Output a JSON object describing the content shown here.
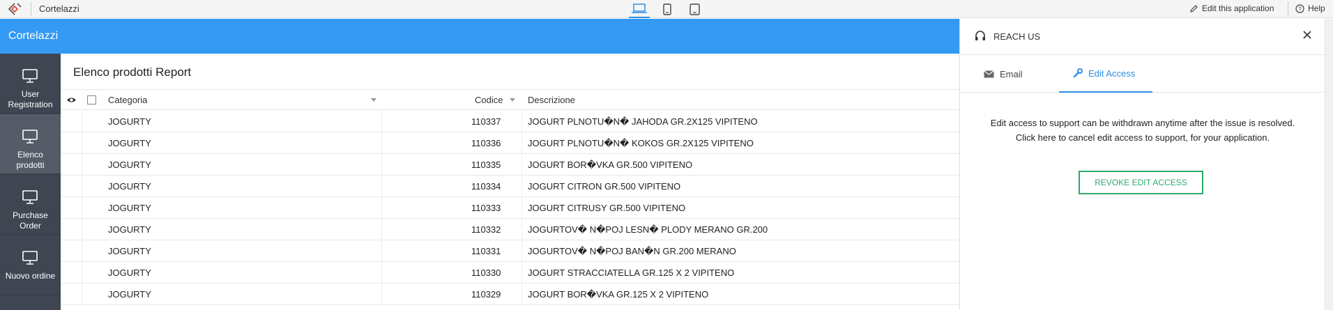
{
  "topbar": {
    "app_name": "Cortelazzi",
    "edit_app_label": "Edit this application",
    "help_label": "Help"
  },
  "header": {
    "title": "Cortelazzi"
  },
  "sidebar": {
    "items": [
      {
        "label_line1": "User",
        "label_line2": "Registration"
      },
      {
        "label_line1": "Elenco",
        "label_line2": "prodotti"
      },
      {
        "label_line1": "Purchase",
        "label_line2": "Order"
      },
      {
        "label_line1": "Nuovo ordine",
        "label_line2": ""
      }
    ]
  },
  "report": {
    "title": "Elenco prodotti Report",
    "columns": {
      "categoria": "Categoria",
      "codice": "Codice",
      "descrizione": "Descrizione"
    },
    "rows": [
      {
        "categoria": "JOGURTY",
        "codice": "110337",
        "descrizione": "JOGURT PLNOTU�N� JAHODA GR.2X125 VIPITENO"
      },
      {
        "categoria": "JOGURTY",
        "codice": "110336",
        "descrizione": "JOGURT PLNOTU�N� KOKOS GR.2X125 VIPITENO"
      },
      {
        "categoria": "JOGURTY",
        "codice": "110335",
        "descrizione": "JOGURT BOR�VKA GR.500 VIPITENO"
      },
      {
        "categoria": "JOGURTY",
        "codice": "110334",
        "descrizione": "JOGURT CITRON GR.500 VIPITENO"
      },
      {
        "categoria": "JOGURTY",
        "codice": "110333",
        "descrizione": "JOGURT CITRUSY GR.500 VIPITENO"
      },
      {
        "categoria": "JOGURTY",
        "codice": "110332",
        "descrizione": "JOGURTOV� N�POJ LESN� PLODY MERANO GR.200"
      },
      {
        "categoria": "JOGURTY",
        "codice": "110331",
        "descrizione": "JOGURTOV� N�POJ BAN�N GR.200 MERANO"
      },
      {
        "categoria": "JOGURTY",
        "codice": "110330",
        "descrizione": "JOGURT STRACCIATELLA GR.125 X 2 VIPITENO"
      },
      {
        "categoria": "JOGURTY",
        "codice": "110329",
        "descrizione": "JOGURT BOR�VKA GR.125 X 2 VIPITENO"
      }
    ]
  },
  "panel": {
    "title": "REACH US",
    "tabs": [
      {
        "label": "Email"
      },
      {
        "label": "Edit Access"
      }
    ],
    "message_line1": "Edit access to support can be withdrawn anytime after the issue is resolved.",
    "message_line2": "Click here to cancel edit access to support, for your application.",
    "revoke_label": "REVOKE EDIT ACCESS"
  },
  "colors": {
    "header_blue": "#3399f3",
    "sidebar_bg": "#3f4652",
    "accent": "#2d8de4",
    "revoke_green": "#2eaa6e"
  },
  "icons": [
    "app-logo-icon",
    "laptop-icon",
    "phone-icon",
    "tablet-icon",
    "pencil-icon",
    "help-icon",
    "monitor-icon",
    "eye-icon",
    "sort-arrow-icon",
    "headset-icon",
    "close-icon",
    "mail-icon",
    "wrench-icon"
  ]
}
